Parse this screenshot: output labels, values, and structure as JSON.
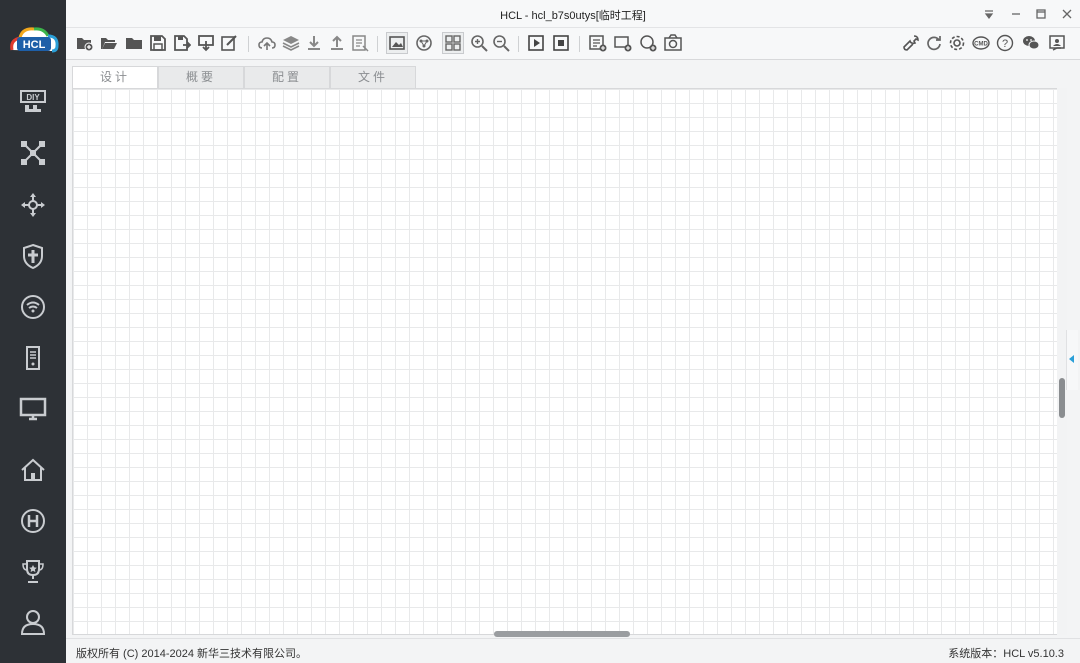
{
  "window": {
    "title": "HCL - hcl_b7s0utys[临时工程]"
  },
  "logo": {
    "text": "HCL"
  },
  "sidebar": {
    "items": [
      {
        "icon": "diy-icon"
      },
      {
        "icon": "network-topology-icon"
      },
      {
        "icon": "move-arrows-icon"
      },
      {
        "icon": "shield-icon"
      },
      {
        "icon": "wifi-icon"
      },
      {
        "icon": "server-icon"
      },
      {
        "icon": "monitor-icon"
      },
      {
        "icon": "home-icon"
      },
      {
        "icon": "h-logo-icon"
      },
      {
        "icon": "trophy-icon"
      },
      {
        "icon": "user-icon"
      }
    ]
  },
  "tabs": [
    {
      "label": "设计",
      "active": true
    },
    {
      "label": "概要",
      "active": false
    },
    {
      "label": "配置",
      "active": false
    },
    {
      "label": "文件",
      "active": false
    }
  ],
  "status": {
    "copyright": "版权所有 (C) 2014-2024 新华三技术有限公司。",
    "version": "系统版本：HCL v5.10.3"
  },
  "colors": {
    "sidebar_bg": "#2d3136",
    "grid_line": "#e8e9ea",
    "accent": "#2a9fd8"
  }
}
